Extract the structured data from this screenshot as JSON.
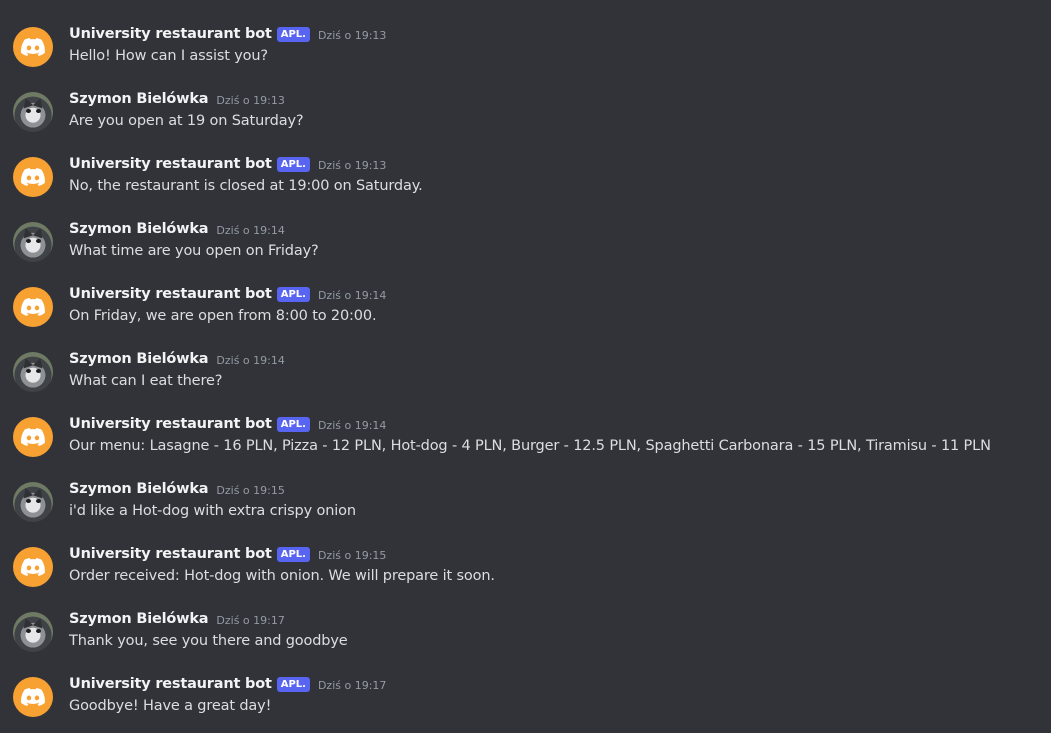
{
  "icons": {
    "bot_avatar": "discord-logo-icon",
    "user_avatar": "cat-photo-avatar"
  },
  "colors": {
    "background": "#313338",
    "bot_avatar_bg": "#f6a132",
    "app_badge_bg": "#5865f2"
  },
  "messages": [
    {
      "author": "University restaurant bot",
      "is_bot": true,
      "badge": "APL.",
      "time": "Dziś o 19:13",
      "text": "Hello! How can I assist you?"
    },
    {
      "author": "Szymon Bielówka",
      "is_bot": false,
      "time": "Dziś o 19:13",
      "text": "Are you open at 19 on Saturday?"
    },
    {
      "author": "University restaurant bot",
      "is_bot": true,
      "badge": "APL.",
      "time": "Dziś o 19:13",
      "text": "No, the restaurant is closed at 19:00 on Saturday."
    },
    {
      "author": "Szymon Bielówka",
      "is_bot": false,
      "time": "Dziś o 19:14",
      "text": "What time are you open on Friday?"
    },
    {
      "author": "University restaurant bot",
      "is_bot": true,
      "badge": "APL.",
      "time": "Dziś o 19:14",
      "text": "On Friday, we are open from 8:00 to 20:00."
    },
    {
      "author": "Szymon Bielówka",
      "is_bot": false,
      "time": "Dziś o 19:14",
      "text": "What can I eat there?"
    },
    {
      "author": "University restaurant bot",
      "is_bot": true,
      "badge": "APL.",
      "time": "Dziś o 19:14",
      "text": "Our menu: Lasagne - 16 PLN, Pizza - 12 PLN, Hot-dog - 4 PLN, Burger - 12.5 PLN, Spaghetti Carbonara - 15 PLN, Tiramisu - 11 PLN"
    },
    {
      "author": "Szymon Bielówka",
      "is_bot": false,
      "time": "Dziś o 19:15",
      "text": "i'd like a Hot-dog with extra crispy onion"
    },
    {
      "author": "University restaurant bot",
      "is_bot": true,
      "badge": "APL.",
      "time": "Dziś o 19:15",
      "text": "Order received: Hot-dog with onion. We will prepare it soon."
    },
    {
      "author": "Szymon Bielówka",
      "is_bot": false,
      "time": "Dziś o 19:17",
      "text": "Thank you, see you there and goodbye"
    },
    {
      "author": "University restaurant bot",
      "is_bot": true,
      "badge": "APL.",
      "time": "Dziś o 19:17",
      "text": "Goodbye! Have a great day!"
    }
  ]
}
